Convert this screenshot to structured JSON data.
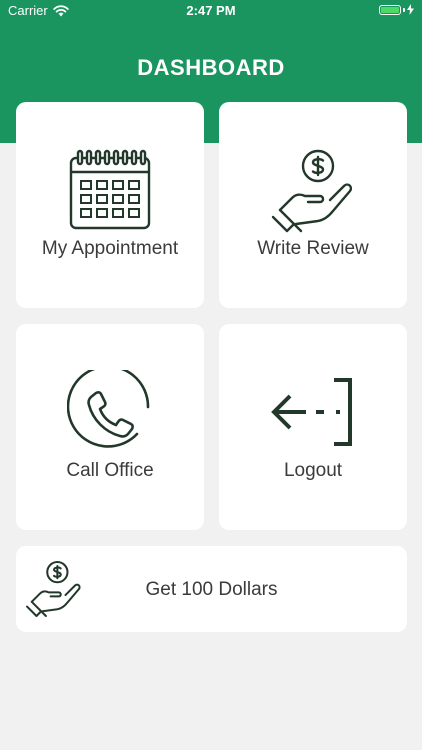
{
  "status_bar": {
    "carrier": "Carrier",
    "time": "2:47 PM",
    "wifi_icon": "wifi-icon",
    "battery_icon": "battery-icon"
  },
  "header": {
    "title": "DASHBOARD"
  },
  "tiles": [
    {
      "label": "My Appointment",
      "icon": "calendar-icon"
    },
    {
      "label": "Write Review",
      "icon": "hand-coin-icon"
    },
    {
      "label": "Call Office",
      "icon": "phone-icon"
    },
    {
      "label": "Logout",
      "icon": "logout-icon"
    },
    {
      "label": "Get 100 Dollars",
      "icon": "hand-coin-icon"
    }
  ],
  "colors": {
    "brand_green": "#1b955f",
    "icon_dark_green": "#22382a",
    "background": "#f1f1f1",
    "tile_background": "#ffffff"
  }
}
